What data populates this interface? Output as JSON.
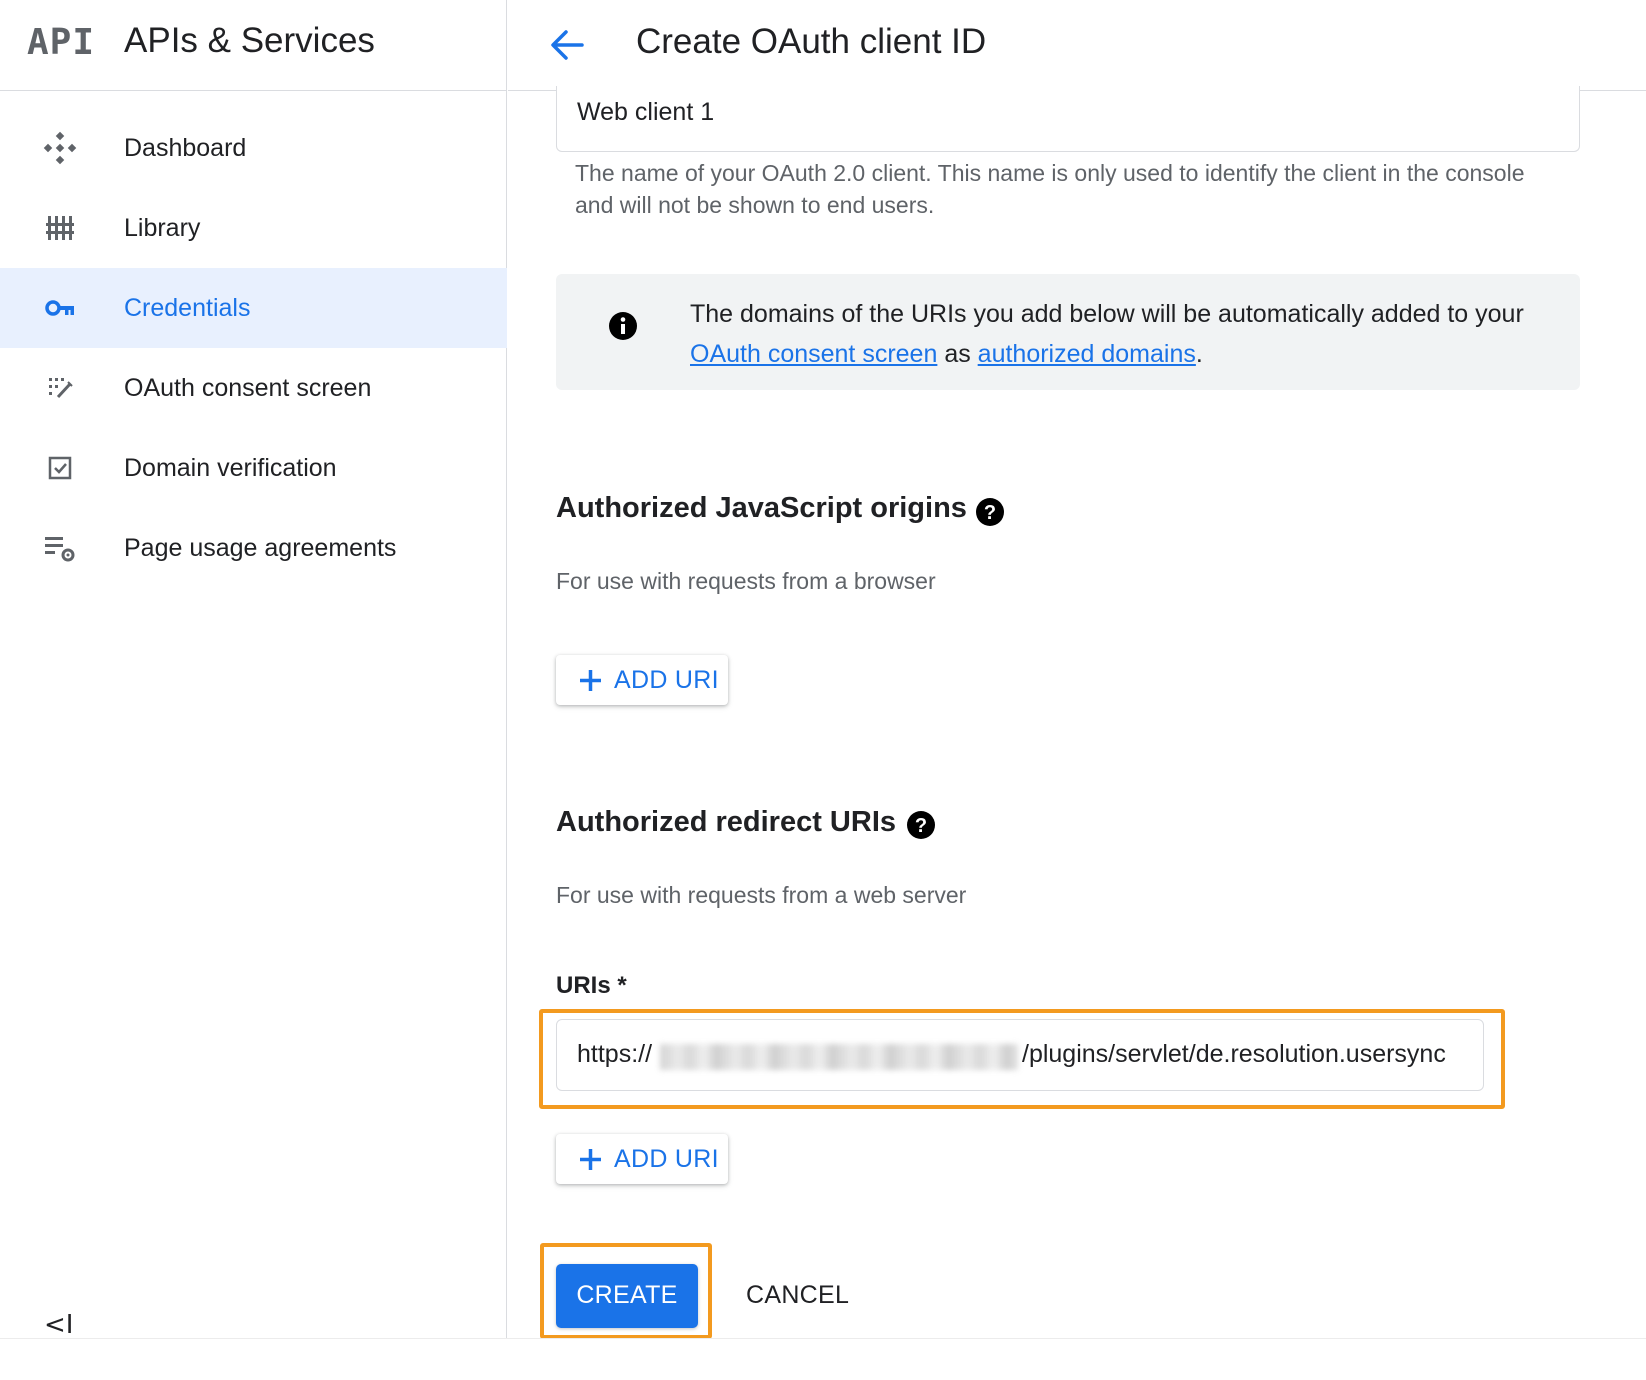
{
  "sidebar": {
    "logo": "API",
    "title": "APIs & Services",
    "items": [
      {
        "label": "Dashboard",
        "icon": "dashboard-icon"
      },
      {
        "label": "Library",
        "icon": "library-icon"
      },
      {
        "label": "Credentials",
        "icon": "key-icon",
        "active": true
      },
      {
        "label": "OAuth consent screen",
        "icon": "consent-icon"
      },
      {
        "label": "Domain verification",
        "icon": "checkbox-icon"
      },
      {
        "label": "Page usage agreements",
        "icon": "settings-list-icon"
      }
    ],
    "collapse": "<I"
  },
  "header": {
    "back_icon": "arrow-back-icon",
    "title": "Create OAuth client ID"
  },
  "form": {
    "name_value": "Web client 1",
    "name_helper": "The name of your OAuth 2.0 client. This name is only used to identify the client in the console and will not be shown to end users.",
    "info": {
      "text_before": "The domains of the URIs you add below will be automatically added to your ",
      "link1": "OAuth consent screen",
      "text_mid": " as ",
      "link2": "authorized domains",
      "text_after": "."
    },
    "js_origins": {
      "title": "Authorized JavaScript origins",
      "subtitle": "For use with requests from a browser",
      "add_label": "ADD URI"
    },
    "redirect_uris": {
      "title": "Authorized redirect URIs",
      "subtitle": "For use with requests from a web server",
      "uris_label": "URIs *",
      "uri_prefix": "https://",
      "uri_suffix": "/plugins/servlet/de.resolution.usersync",
      "add_label": "ADD URI"
    },
    "create_label": "CREATE",
    "cancel_label": "CANCEL"
  },
  "colors": {
    "accent": "#1a73e8",
    "highlight": "#f39a1f",
    "active_bg": "#e8f0fe"
  }
}
